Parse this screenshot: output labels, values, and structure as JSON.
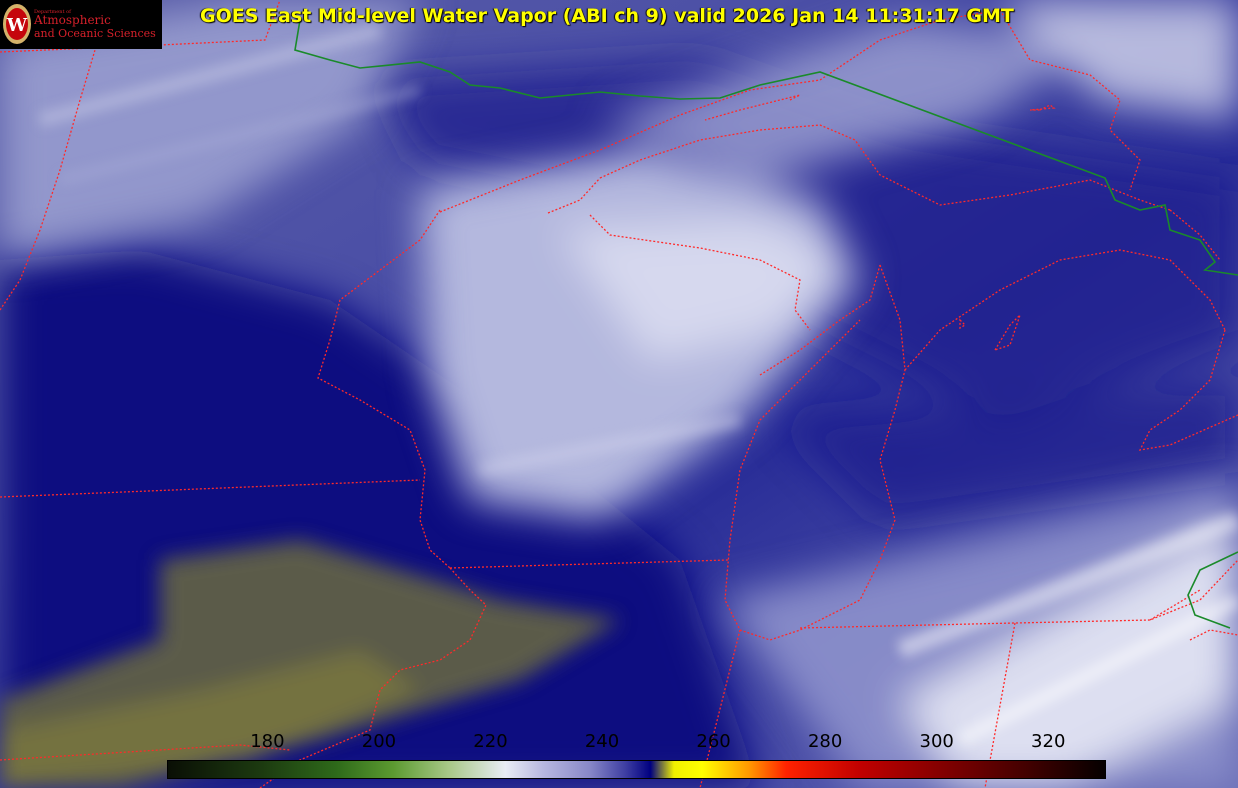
{
  "title": "GOES East Mid-level Water Vapor (ABI ch 9)  valid 2026 Jan 14 11:31:17 GMT",
  "logo": {
    "dept": "Department of",
    "line1": "Atmospheric",
    "line2": "and Oceanic Sciences",
    "seal_letter": "W"
  },
  "colorbar": {
    "ticks": [
      "180",
      "200",
      "220",
      "240",
      "260",
      "280",
      "300",
      "320"
    ],
    "range": [
      162,
      330
    ]
  },
  "colors": {
    "title": "#ffff00",
    "state_borders": "#ff2a2a",
    "country_border": "#1a8a2a",
    "vapor_dark": "#0a0a78",
    "vapor_light": "#c8cce6"
  }
}
